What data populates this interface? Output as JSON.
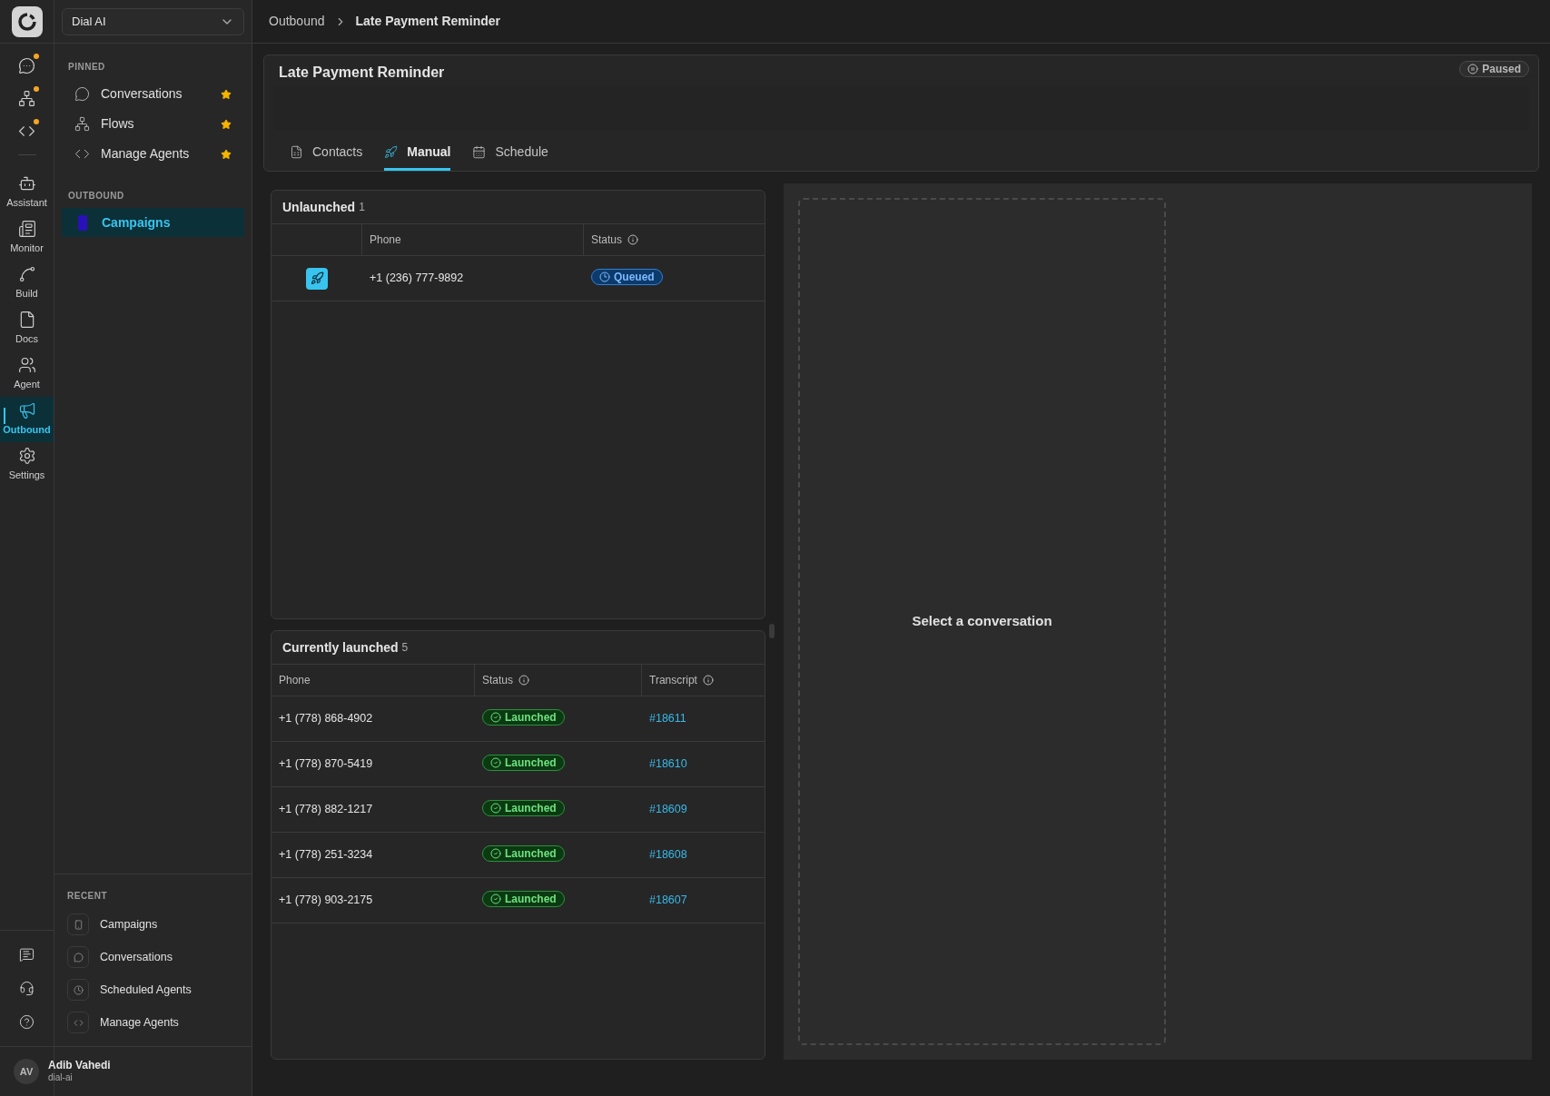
{
  "rail": {
    "top_items": [
      {
        "notification": true
      },
      {
        "notification": true
      },
      {
        "notification": true
      }
    ],
    "nav_items": [
      {
        "label": "Assistant",
        "selected": false
      },
      {
        "label": "Monitor",
        "selected": false
      },
      {
        "label": "Build",
        "selected": false
      },
      {
        "label": "Docs",
        "selected": false
      },
      {
        "label": "Agent",
        "selected": false
      },
      {
        "label": "Outbound",
        "selected": true
      },
      {
        "label": "Settings",
        "selected": false
      }
    ]
  },
  "sidebar": {
    "workspace": "Dial AI",
    "pinned": {
      "title": "PINNED",
      "items": [
        {
          "label": "Conversations",
          "starred": true
        },
        {
          "label": "Flows",
          "starred": true
        },
        {
          "label": "Manage Agents",
          "starred": true
        }
      ]
    },
    "outbound": {
      "title": "OUTBOUND",
      "items": [
        {
          "label": "Campaigns",
          "selected": true
        }
      ]
    },
    "recent": {
      "title": "RECENT",
      "items": [
        {
          "label": "Campaigns"
        },
        {
          "label": "Conversations"
        },
        {
          "label": "Scheduled Agents"
        },
        {
          "label": "Manage Agents"
        }
      ]
    },
    "user": {
      "initials": "AV",
      "name": "Adib Vahedi",
      "handle": "dial-ai"
    }
  },
  "breadcrumb": [
    "Outbound",
    "Late Payment Reminder"
  ],
  "campaign": {
    "title": "Late Payment Reminder",
    "status": {
      "label": "Paused",
      "kind": "paused"
    },
    "tabs": [
      {
        "label": "Contacts",
        "selected": false
      },
      {
        "label": "Manual",
        "selected": true
      },
      {
        "label": "Schedule",
        "selected": false
      }
    ]
  },
  "unlaunched": {
    "title": "Unlaunched",
    "count": "1",
    "columns": [
      "Phone",
      "Status"
    ],
    "rows": [
      {
        "phone": "+1 (236) 777-9892",
        "status": {
          "label": "Queued",
          "kind": "queued"
        }
      }
    ]
  },
  "launched": {
    "title": "Currently launched",
    "count": "5",
    "columns": [
      "Phone",
      "Status",
      "Transcript"
    ],
    "rows": [
      {
        "phone": "+1 (778) 868-4902",
        "status": {
          "label": "Launched",
          "kind": "launched"
        },
        "transcript": "#18611"
      },
      {
        "phone": "+1 (778) 870-5419",
        "status": {
          "label": "Launched",
          "kind": "launched"
        },
        "transcript": "#18610"
      },
      {
        "phone": "+1 (778) 882-1217",
        "status": {
          "label": "Launched",
          "kind": "launched"
        },
        "transcript": "#18609"
      },
      {
        "phone": "+1 (778) 251-3234",
        "status": {
          "label": "Launched",
          "kind": "launched"
        },
        "transcript": "#18608"
      },
      {
        "phone": "+1 (778) 903-2175",
        "status": {
          "label": "Launched",
          "kind": "launched"
        },
        "transcript": "#18607"
      }
    ]
  },
  "detail": {
    "placeholder": "Select a conversation"
  }
}
